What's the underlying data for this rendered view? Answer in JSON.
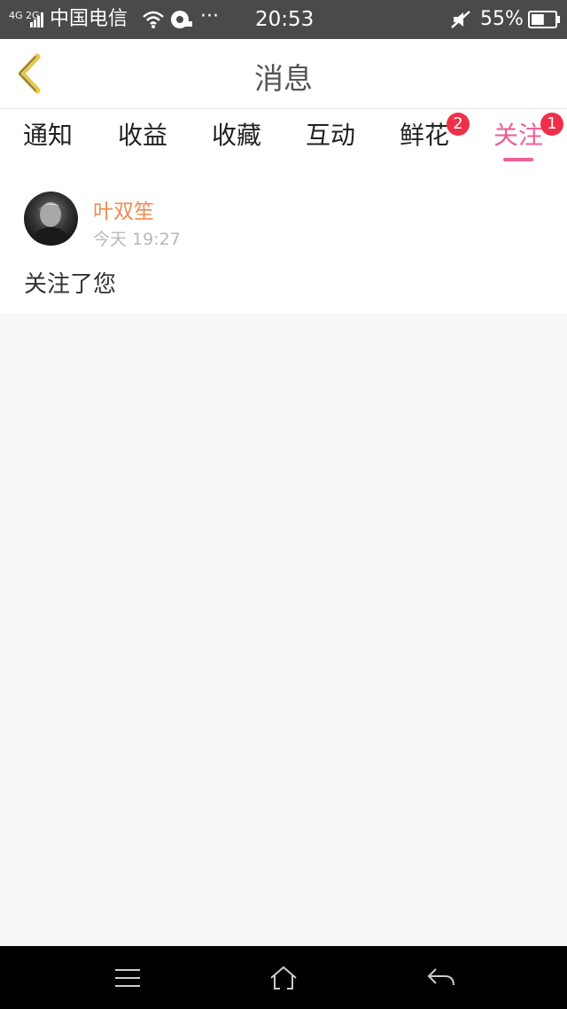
{
  "status_bar": {
    "network_type": "4G 2G",
    "carrier": "中国电信",
    "more": "···",
    "time": "20:53",
    "battery": "55%",
    "battery_level": 0.55,
    "icons": [
      "signal-icon",
      "wifi-icon",
      "notification-icon",
      "mute-icon",
      "battery-icon"
    ]
  },
  "header": {
    "title": "消息",
    "back_icon": "chevron-left-icon",
    "back_color": "#e6c84a"
  },
  "tabs": [
    {
      "label": "通知",
      "badge": "",
      "active": false
    },
    {
      "label": "收益",
      "badge": "",
      "active": false
    },
    {
      "label": "收藏",
      "badge": "",
      "active": false
    },
    {
      "label": "互动",
      "badge": "",
      "active": false
    },
    {
      "label": "鲜花",
      "badge": "2",
      "active": false
    },
    {
      "label": "关注",
      "badge": "1",
      "active": true
    }
  ],
  "message": {
    "username": "叶双笙",
    "time": "今天 19:27",
    "text": "关注了您"
  },
  "nav_bar": {
    "icons": [
      "menu-icon",
      "home-icon",
      "back-icon"
    ]
  },
  "colors": {
    "accent": "#ef5f9a",
    "badge": "#f0304a",
    "username": "#ef8b54"
  }
}
